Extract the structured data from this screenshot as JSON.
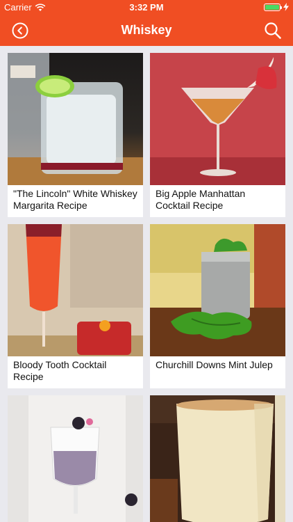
{
  "status": {
    "carrier": "Carrier",
    "time": "3:32 PM"
  },
  "nav": {
    "title": "Whiskey",
    "back_icon": "chevron-left-icon",
    "search_icon": "search-icon"
  },
  "recipes": [
    {
      "title": "\"The Lincoln\" White Whiskey Margarita Recipe"
    },
    {
      "title": "Big Apple Manhattan Cocktail Recipe"
    },
    {
      "title": "Bloody Tooth Cocktail Recipe"
    },
    {
      "title": "Churchill Downs Mint Julep"
    },
    {
      "title": ""
    },
    {
      "title": ""
    }
  ],
  "colors": {
    "header": "#f04e23",
    "background": "#e9e9ee",
    "battery": "#4cd964"
  }
}
